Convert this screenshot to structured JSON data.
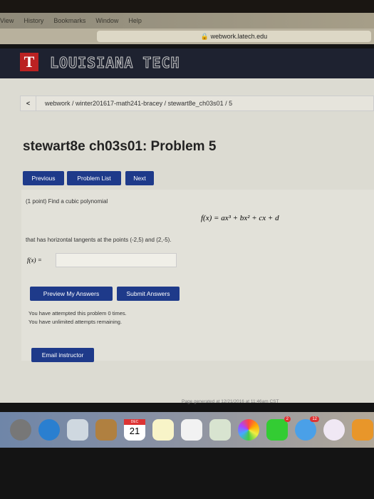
{
  "menubar": [
    "View",
    "History",
    "Bookmarks",
    "Window",
    "Help"
  ],
  "url": "webwork.latech.edu",
  "banner": {
    "logo_letter": "T",
    "name": "LOUISIANA TECH"
  },
  "breadcrumb": {
    "back": "<",
    "path": "webwork / winter201617-math241-bracey / stewart8e_ch03s01 / 5"
  },
  "title": "stewart8e ch03s01: Problem 5",
  "nav": {
    "previous": "Previous",
    "list": "Problem List",
    "next": "Next"
  },
  "problem": {
    "intro": "(1 point) Find a cubic polynomial",
    "formula": "f(x) = ax³ + bx² + cx + d",
    "condition": "that has horizontal tangents at the points (-2,5) and (2,-5).",
    "answer_label": "f(x) =",
    "answer_value": ""
  },
  "actions": {
    "preview": "Preview My Answers",
    "submit": "Submit Answers"
  },
  "status": [
    "You have attempted this problem 0 times.",
    "You have unlimited attempts remaining."
  ],
  "email": "Email instructor",
  "footer": "Page generated at 12/21/2016 at 11:46am CST",
  "dock": {
    "calendar_month": "DEC",
    "calendar_day": "21",
    "facetime_badge": "2",
    "messages_badge": "12"
  }
}
